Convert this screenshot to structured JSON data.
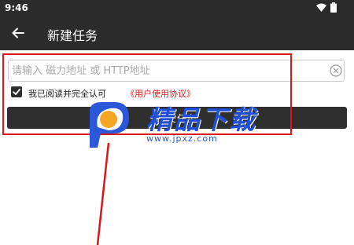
{
  "status_bar": {
    "time": "9:46",
    "icons": [
      "wifi-icon",
      "battery-icon"
    ]
  },
  "toolbar": {
    "title": "新建任务",
    "back_icon": "arrow-left-icon"
  },
  "form": {
    "url_input": {
      "placeholder": "请输入 磁力地址 或 HTTP地址",
      "value": ""
    },
    "clear_icon": "clear-circle-icon",
    "agreement": {
      "checked": true,
      "text": "我已阅读并完全认可",
      "link_text": "《用户使用协议》"
    },
    "submit_button": {
      "label": "提交任务"
    }
  },
  "watermark": {
    "title": "精品下载",
    "url": "www.jpxz.com",
    "logo": "jp-logo"
  },
  "colors": {
    "bar_background": "#2b2b2b",
    "highlight": "#d9161a",
    "link": "#e02020",
    "watermark_blue": "#1f4fd6",
    "watermark_orange": "#f5a623"
  }
}
